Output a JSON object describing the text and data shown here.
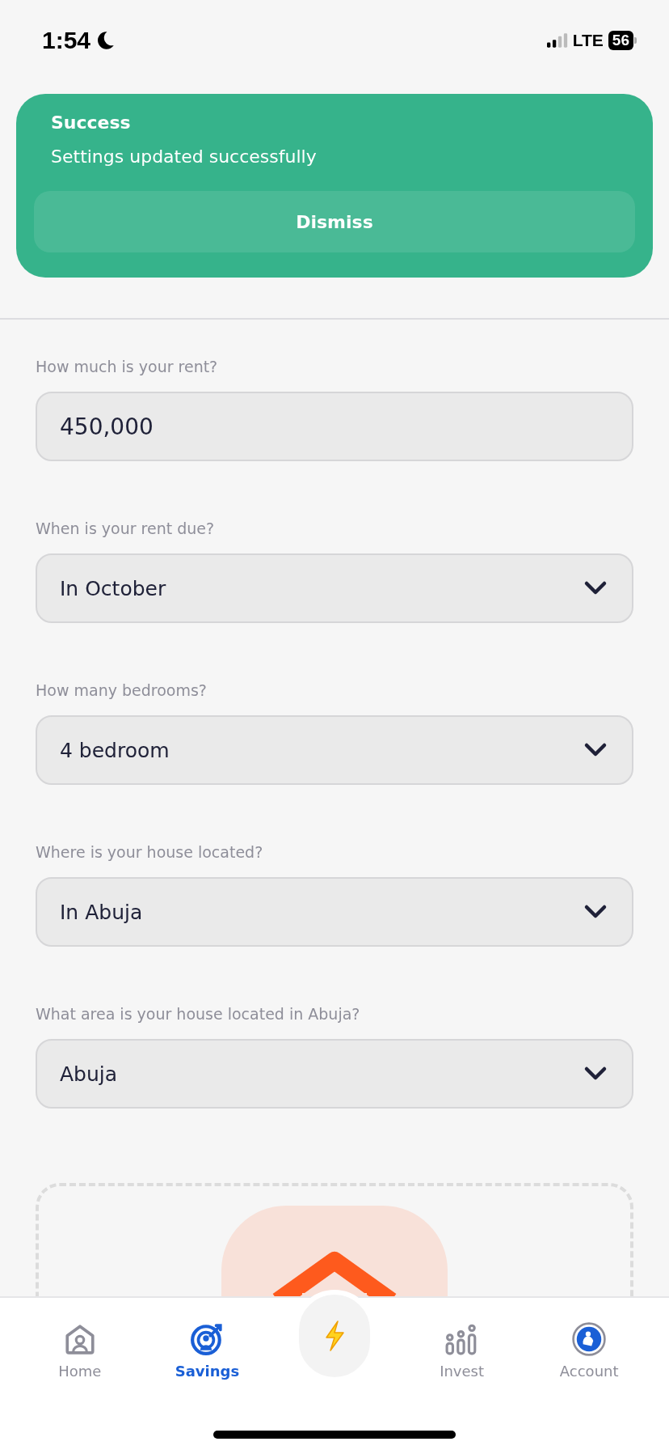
{
  "status_bar": {
    "time": "1:54",
    "network": "LTE",
    "battery": "56"
  },
  "toast": {
    "title": "Success",
    "message": "Settings updated successfully",
    "button": "Dismiss"
  },
  "fields": [
    {
      "label": "How much is your rent?",
      "kind": "input",
      "value": "450,000"
    },
    {
      "label": "When is your rent due?",
      "kind": "select",
      "value": "In October"
    },
    {
      "label": "How many bedrooms?",
      "kind": "select",
      "value": "4 bedroom"
    },
    {
      "label": "Where is your house located?",
      "kind": "select",
      "value": "In Abuja"
    },
    {
      "label": "What area is your house located in Abuja?",
      "kind": "select",
      "value": "Abuja"
    }
  ],
  "tab_bar": [
    {
      "kind": "home",
      "label": "Home",
      "selected": false
    },
    {
      "kind": "savings",
      "label": "Savings",
      "selected": true
    },
    {
      "kind": "action",
      "selected": false
    },
    {
      "kind": "invest",
      "label": "Invest",
      "selected": false
    },
    {
      "kind": "account",
      "label": "Account",
      "selected": false
    }
  ]
}
